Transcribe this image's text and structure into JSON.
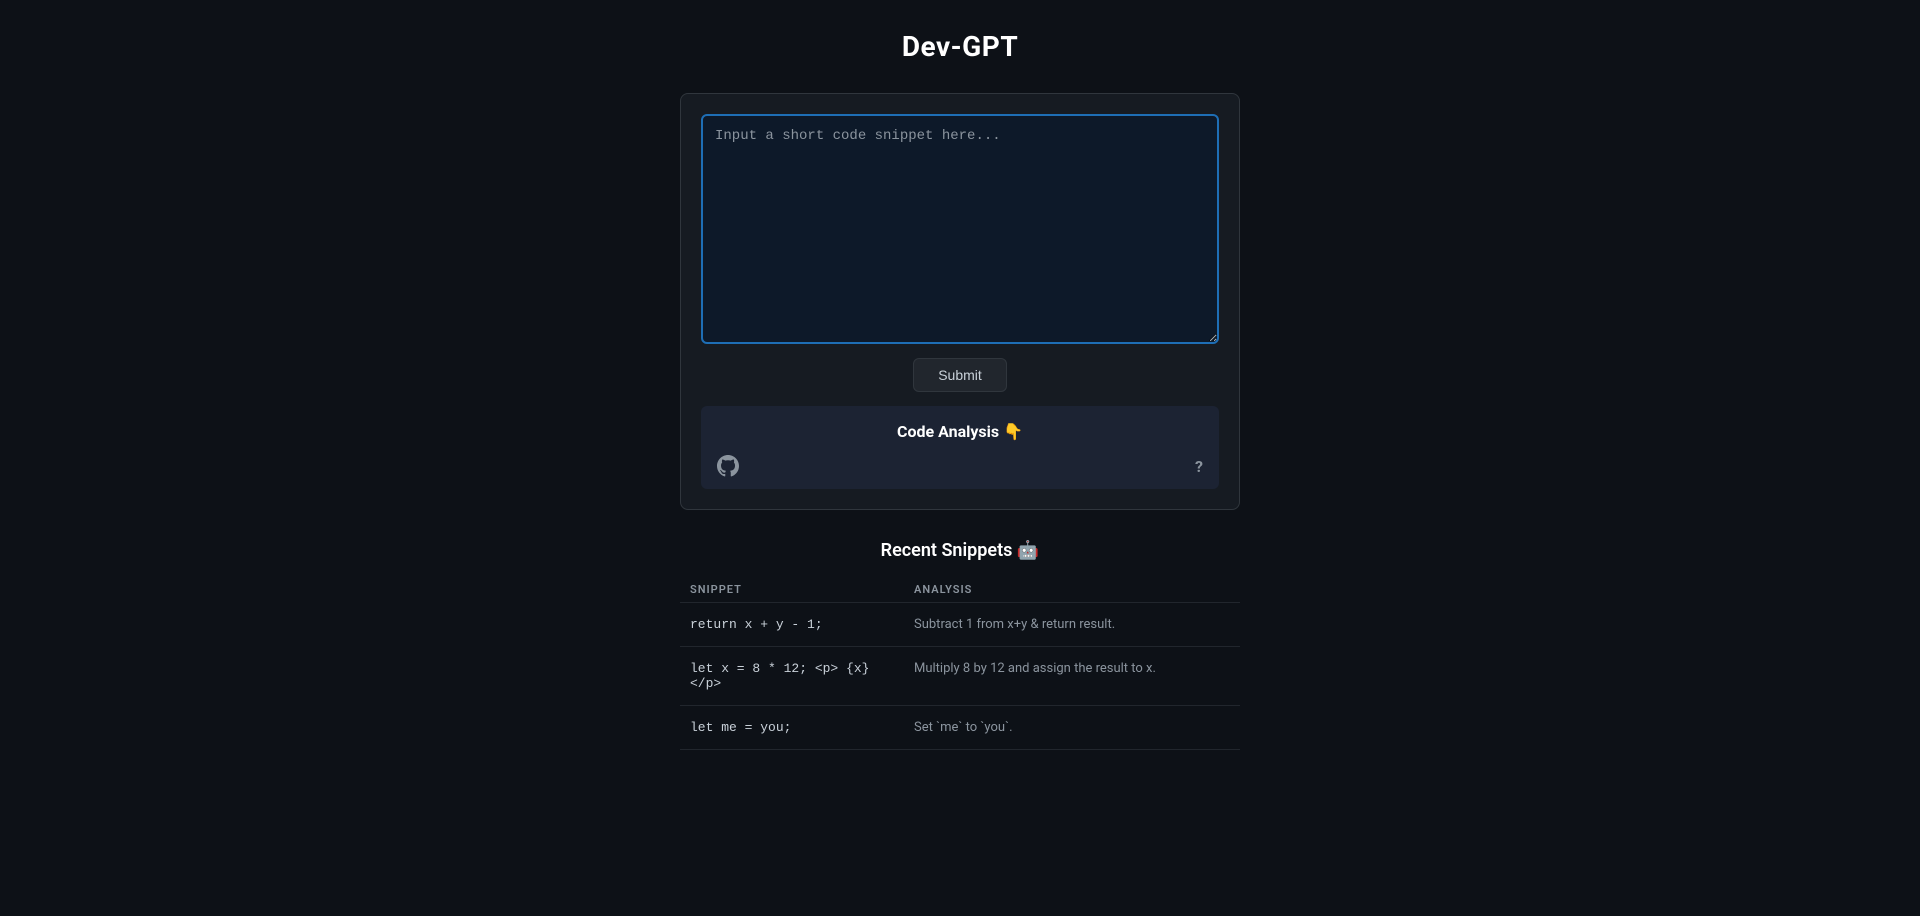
{
  "header": {
    "title": "Dev-GPT"
  },
  "input_panel": {
    "textarea_placeholder": "Input a short code snippet here...",
    "submit_button_label": "Submit"
  },
  "analysis_panel": {
    "title": "Code Analysis",
    "title_emoji": "👇",
    "github_icon_label": "github-icon",
    "help_icon_label": "?"
  },
  "recent_snippets": {
    "title": "Recent Snippets",
    "title_emoji": "🤖",
    "columns": [
      {
        "key": "snippet",
        "label": "SNIPPET"
      },
      {
        "key": "analysis",
        "label": "ANALYSIS"
      }
    ],
    "rows": [
      {
        "snippet": "return x + y - 1;",
        "analysis": "Subtract 1 from x+y & return result."
      },
      {
        "snippet": "let x = 8 * 12; <p> {x} </p>",
        "analysis": "Multiply 8 by 12 and assign the result to x."
      },
      {
        "snippet": "let me = you;",
        "analysis": "Set `me` to `you`."
      }
    ]
  }
}
